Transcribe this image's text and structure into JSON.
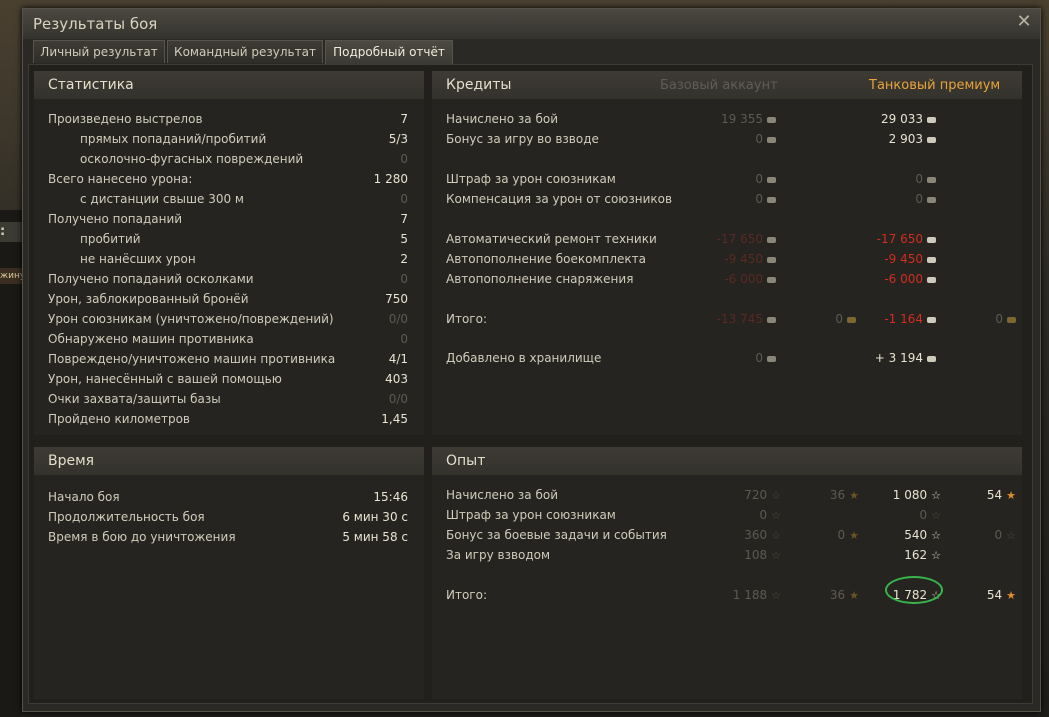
{
  "window": {
    "title": "Результаты боя",
    "close": "✕"
  },
  "tabs": [
    "Личный результат",
    "Командный результат",
    "Подробный отчёт"
  ],
  "background": {
    "tag1": ": Сл",
    "tag2": "жину"
  },
  "stats": {
    "title": "Статистика",
    "rows": [
      {
        "label": "Произведено выстрелов",
        "value": "7"
      },
      {
        "label": "прямых попаданий/пробитий",
        "value": "5/3"
      },
      {
        "label": "осколочно-фугасных повреждений",
        "value": "0"
      },
      {
        "label": "Всего нанесено урона:",
        "value": "1 280"
      },
      {
        "label": "с дистанции свыше 300 м",
        "value": "0"
      },
      {
        "label": "Получено попаданий",
        "value": "7"
      },
      {
        "label": "пробитий",
        "value": "5"
      },
      {
        "label": "не нанёсших урон",
        "value": "2"
      },
      {
        "label": "Получено попаданий осколками",
        "value": "0"
      },
      {
        "label": "Урон, заблокированный бронёй",
        "value": "750"
      },
      {
        "label": "Урон союзникам (уничтожено/повреждений)",
        "value": "0/0"
      },
      {
        "label": "Обнаружено машин противника",
        "value": "0"
      },
      {
        "label": "Повреждено/уничтожено машин противника",
        "value": "4/1"
      },
      {
        "label": "Урон, нанесённый с вашей помощью",
        "value": "403"
      },
      {
        "label": "Очки захвата/защиты базы",
        "value": "0/0"
      },
      {
        "label": "Пройдено километров",
        "value": "1,45"
      }
    ]
  },
  "time": {
    "title": "Время",
    "rows": [
      {
        "label": "Начало боя",
        "value": "15:46"
      },
      {
        "label": "Продолжительность боя",
        "value": "6 мин 30 с"
      },
      {
        "label": "Время в бою до уничтожения",
        "value": "5 мин 58 с"
      }
    ]
  },
  "credits": {
    "title": "Кредиты",
    "col_base": "Базовый аккаунт",
    "col_premium": "Танковый премиум",
    "rows": [
      {
        "label": "Начислено за бой",
        "base": "19 355",
        "prem": "29 033"
      },
      {
        "label": "Бонус за игру во взводе",
        "base": "0",
        "prem": "2 903"
      },
      {
        "label": "Штраф за урон союзникам",
        "base": "0",
        "prem": "0"
      },
      {
        "label": "Компенсация за урон от союзников",
        "base": "0",
        "prem": "0"
      },
      {
        "label": "Автоматический ремонт техники",
        "base": "-17 650",
        "prem": "-17 650"
      },
      {
        "label": "Автопополнение боекомплекта",
        "base": "-9 450",
        "prem": "-9 450"
      },
      {
        "label": "Автопополнение снаряжения",
        "base": "-6 000",
        "prem": "-6 000"
      },
      {
        "label": "Итого:",
        "base": "-13 745",
        "base_gold": "0",
        "prem": "-1 164",
        "prem_gold": "0"
      },
      {
        "label": "Добавлено в хранилище",
        "base": "0",
        "prem": "+ 3 194"
      }
    ]
  },
  "xp": {
    "title": "Опыт",
    "rows": [
      {
        "label": "Начислено за бой",
        "base": "720",
        "base_free": "36",
        "prem": "1 080",
        "prem_free": "54"
      },
      {
        "label": "Штраф за урон союзникам",
        "base": "0",
        "base_free": "",
        "prem": "0",
        "prem_free": ""
      },
      {
        "label": "Бонус за боевые задачи и события",
        "base": "360",
        "base_free": "0",
        "prem": "540",
        "prem_free": "0"
      },
      {
        "label": "За игру взводом",
        "base": "108",
        "base_free": "",
        "prem": "162",
        "prem_free": ""
      },
      {
        "label": "Итого:",
        "base": "1 188",
        "base_free": "36",
        "prem": "1 782",
        "prem_free": "54"
      }
    ]
  },
  "icons": {
    "credit": "credit-icon",
    "gold": "gold-icon",
    "xp": "xp-star-icon",
    "free_xp": "free-xp-star-icon"
  },
  "colors": {
    "premium_header": "#e8a33a",
    "negative": "#d22d1e",
    "highlight_circle": "#39b54a",
    "free_xp_star": "#e08e2a"
  }
}
